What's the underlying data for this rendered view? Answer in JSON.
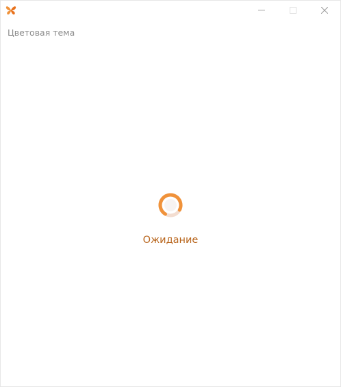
{
  "window": {
    "title": "",
    "app_icon": "butterfly-icon",
    "controls": [
      "minimize-icon",
      "maximize-icon",
      "close-icon"
    ]
  },
  "header": {
    "theme_label": "Цветовая тема"
  },
  "main": {
    "status_text": "Ожидание",
    "loader_icon": "loading-spinner-icon"
  },
  "colors": {
    "accent": "#f0923a",
    "status_text": "#b8651c",
    "label_text": "#8c8c8c"
  }
}
